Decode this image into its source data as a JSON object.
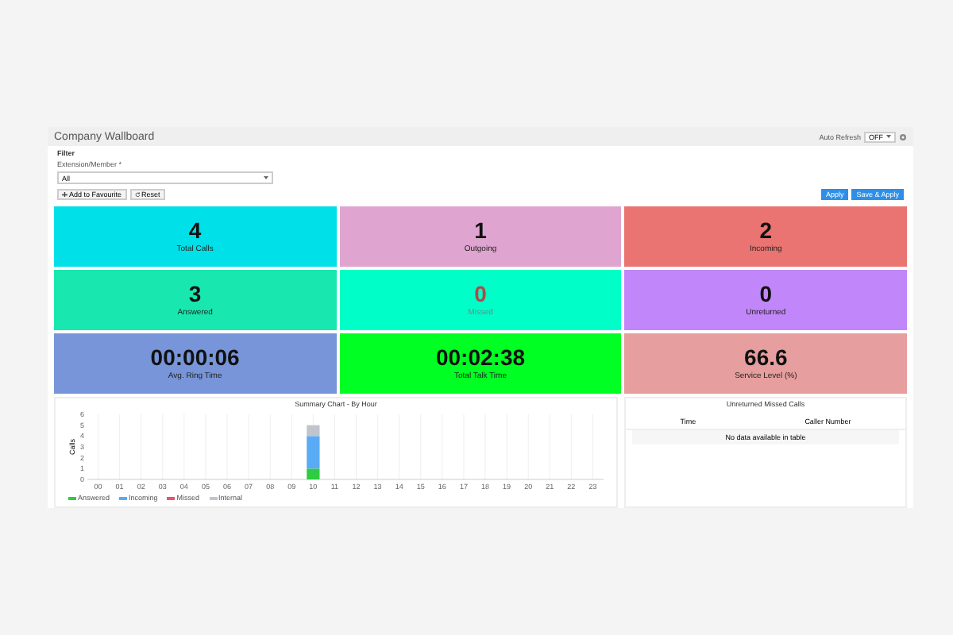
{
  "header": {
    "title": "Company Wallboard",
    "auto_refresh_label": "Auto Refresh",
    "auto_refresh_value": "OFF"
  },
  "filter": {
    "title": "Filter",
    "field_label": "Extension/Member *",
    "field_value": "All",
    "favourite_button": "Add to Favourite",
    "reset_button": "Reset",
    "apply_button": "Apply",
    "save_apply_button": "Save & Apply"
  },
  "tiles": [
    {
      "value": "4",
      "label": "Total Calls",
      "color": "#00e0e8",
      "alert": false
    },
    {
      "value": "1",
      "label": "Outgoing",
      "color": "#dfa4cf",
      "alert": false
    },
    {
      "value": "2",
      "label": "Incoming",
      "color": "#e97471",
      "alert": false
    },
    {
      "value": "3",
      "label": "Answered",
      "color": "#18e8b0",
      "alert": false
    },
    {
      "value": "0",
      "label": "Missed",
      "color": "#00ffc8",
      "alert": true
    },
    {
      "value": "0",
      "label": "Unreturned",
      "color": "#c186f9",
      "alert": false
    },
    {
      "value": "00:00:06",
      "label": "Avg. Ring Time",
      "color": "#7795d8",
      "alert": false
    },
    {
      "value": "00:02:38",
      "label": "Total Talk Time",
      "color": "#00ff22",
      "alert": false
    },
    {
      "value": "66.6",
      "label": "Service Level (%)",
      "color": "#e69e9e",
      "alert": false
    }
  ],
  "summary": {
    "chart_data": {
      "type": "bar",
      "title": "Summary Chart - By Hour",
      "ylabel": "Calls",
      "stacked": true,
      "categories": [
        "00",
        "01",
        "02",
        "03",
        "04",
        "05",
        "06",
        "07",
        "08",
        "09",
        "10",
        "11",
        "12",
        "13",
        "14",
        "15",
        "16",
        "17",
        "18",
        "19",
        "20",
        "21",
        "22",
        "23"
      ],
      "series": [
        {
          "name": "Answered",
          "color": "#2ecc40",
          "values": [
            0,
            0,
            0,
            0,
            0,
            0,
            0,
            0,
            0,
            0,
            1,
            0,
            0,
            0,
            0,
            0,
            0,
            0,
            0,
            0,
            0,
            0,
            0,
            0
          ]
        },
        {
          "name": "Incoming",
          "color": "#5aabf5",
          "values": [
            0,
            0,
            0,
            0,
            0,
            0,
            0,
            0,
            0,
            0,
            3,
            0,
            0,
            0,
            0,
            0,
            0,
            0,
            0,
            0,
            0,
            0,
            0,
            0
          ]
        },
        {
          "name": "Missed",
          "color": "#f05070",
          "values": [
            0,
            0,
            0,
            0,
            0,
            0,
            0,
            0,
            0,
            0,
            0,
            0,
            0,
            0,
            0,
            0,
            0,
            0,
            0,
            0,
            0,
            0,
            0,
            0
          ]
        },
        {
          "name": "Internal",
          "color": "#c0c4cc",
          "values": [
            0,
            0,
            0,
            0,
            0,
            0,
            0,
            0,
            0,
            0,
            1,
            0,
            0,
            0,
            0,
            0,
            0,
            0,
            0,
            0,
            0,
            0,
            0,
            0
          ]
        }
      ],
      "ylim": [
        0,
        6
      ],
      "yticks": [
        0,
        1,
        2,
        3,
        4,
        5,
        6
      ],
      "grid": true
    }
  },
  "unreturned": {
    "title": "Unreturned Missed Calls",
    "columns": [
      "Time",
      "Caller Number"
    ],
    "empty_text": "No data available in table"
  }
}
